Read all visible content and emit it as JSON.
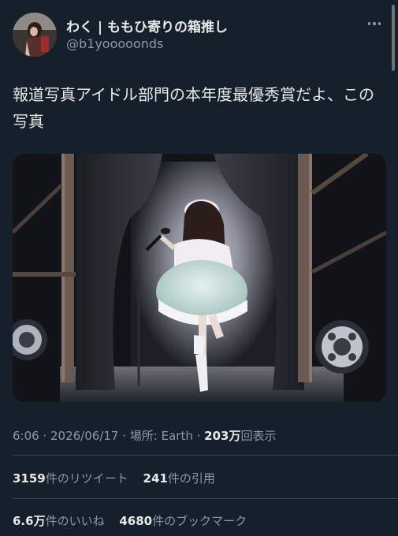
{
  "author": {
    "display_name": "わく | ももひ寄りの箱推し",
    "handle": "@b1yooooonds"
  },
  "tweet": {
    "text": "報道写真アイドル部門の本年度最優秀賞だよ、この写真"
  },
  "meta": {
    "time": "6:06",
    "date": "2026/06/17",
    "location_prefix": "場所: ",
    "location": "Earth",
    "views_count": "203万",
    "views_label": "回表示",
    "separator": " · "
  },
  "stats": {
    "retweets": {
      "count": "3159",
      "label": "件のリツイート"
    },
    "quotes": {
      "count": "241",
      "label": "件の引用"
    },
    "likes": {
      "count": "6.6万",
      "label": "件のいいね"
    },
    "bookmarks": {
      "count": "4680",
      "label": "件のブックマーク"
    }
  },
  "icons": {
    "more": "more-horizontal-icon"
  },
  "colors": {
    "background": "#15202b",
    "text_primary": "#e7e9ea",
    "text_secondary": "#8b98a5",
    "divider": "#38444d"
  }
}
